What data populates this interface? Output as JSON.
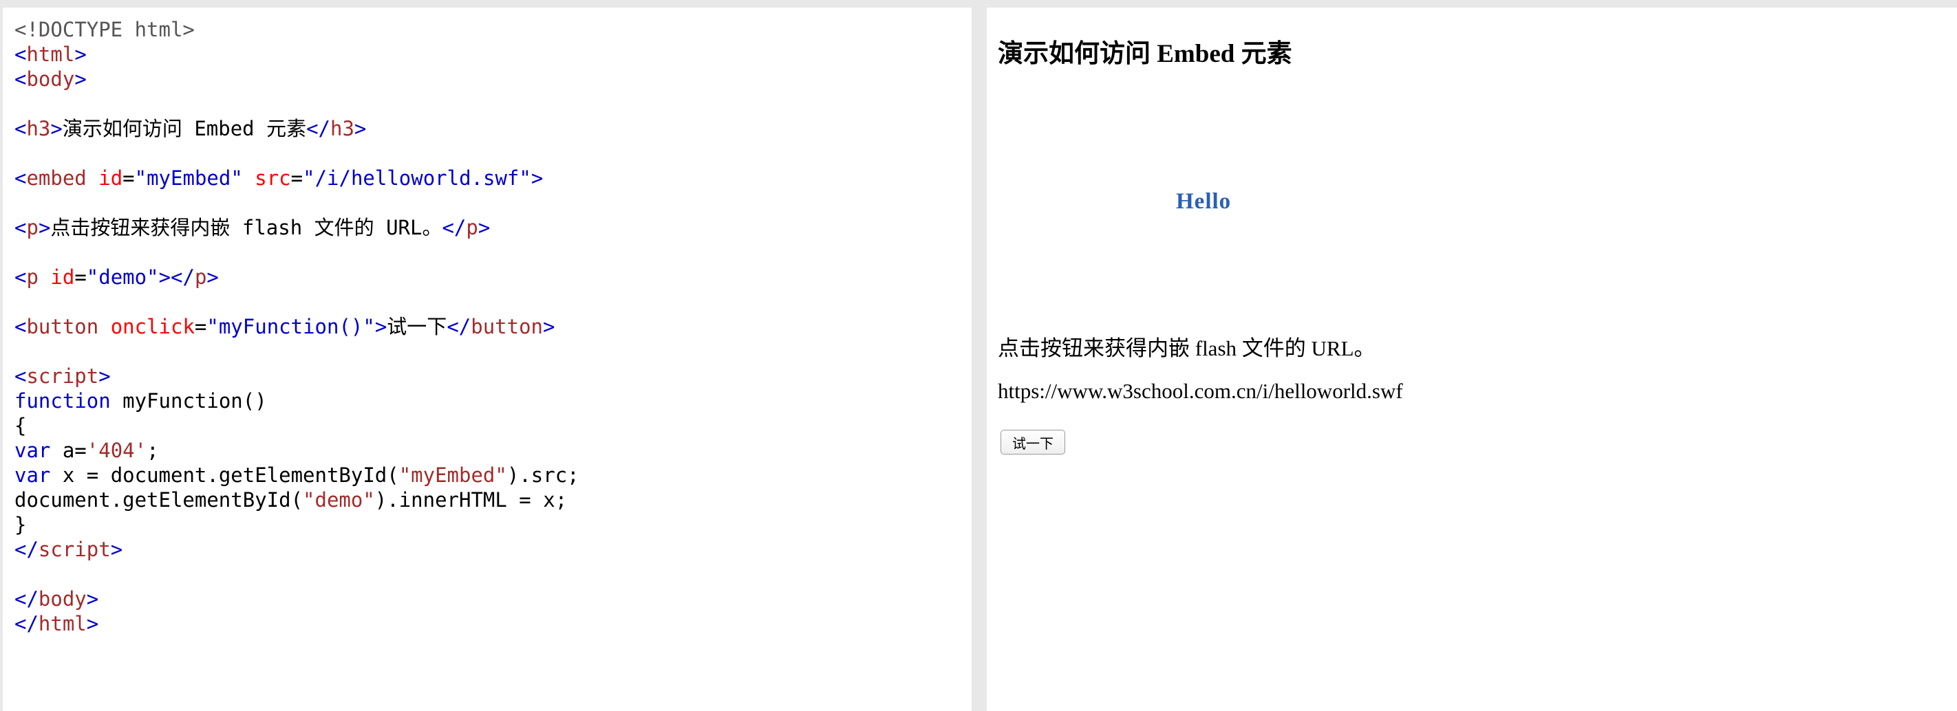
{
  "code_editor": {
    "lines": {
      "l1": "<!DOCTYPE html>",
      "l2_open": "<",
      "l2_tag": "html",
      "l2_close": ">",
      "l3_open": "<",
      "l3_tag": "body",
      "l3_close": ">",
      "l5_open": "<",
      "l5_tag": "h3",
      "l5_close": ">",
      "l5_text": "演示如何访问 Embed 元素",
      "l5_end_open": "</",
      "l5_end_tag": "h3",
      "l5_end_close": ">",
      "l7_open": "<",
      "l7_tag": "embed",
      "l7_attr1": "id",
      "l7_eq1": "=",
      "l7_val1": "\"myEmbed\"",
      "l7_attr2": "src",
      "l7_eq2": "=",
      "l7_val2": "\"/i/helloworld.swf\"",
      "l7_close": ">",
      "l9_open": "<",
      "l9_tag": "p",
      "l9_close": ">",
      "l9_text": "点击按钮来获得内嵌 flash 文件的 URL。",
      "l9_end_open": "</",
      "l9_end_tag": "p",
      "l9_end_close": ">",
      "l11_open": "<",
      "l11_tag": "p",
      "l11_attr": "id",
      "l11_eq": "=",
      "l11_val": "\"demo\"",
      "l11_close": ">",
      "l11_end_open": "</",
      "l11_end_tag": "p",
      "l11_end_close": ">",
      "l13_open": "<",
      "l13_tag": "button",
      "l13_attr": "onclick",
      "l13_eq": "=",
      "l13_val": "\"myFunction()\"",
      "l13_close": ">",
      "l13_text": "试一下",
      "l13_end_open": "</",
      "l13_end_tag": "button",
      "l13_end_close": ">",
      "l15_open": "<",
      "l15_tag": "script",
      "l15_close": ">",
      "l16_kw": "function",
      "l16_rest": " myFunction()",
      "l17": "{",
      "l18_kw": "var",
      "l18_a": " a=",
      "l18_str": "'404'",
      "l18_b": ";",
      "l19_kw": "var",
      "l19_a": " x = document.getElementById(",
      "l19_str": "\"myEmbed\"",
      "l19_b": ").src;",
      "l20_a": "document.getElementById(",
      "l20_str": "\"demo\"",
      "l20_b": ").innerHTML = x;",
      "l21": "}",
      "l22_open": "</",
      "l22_tag": "script",
      "l22_close": ">",
      "l24_open": "</",
      "l24_tag": "body",
      "l24_close": ">",
      "l25_open": "</",
      "l25_tag": "html",
      "l25_close": ">"
    }
  },
  "result": {
    "heading": "演示如何访问 Embed 元素",
    "embed_text": "Hello",
    "intro": "点击按钮来获得内嵌 flash 文件的 URL。",
    "demo_output": "https://www.w3school.com.cn/i/helloworld.swf",
    "button_label": "试一下"
  }
}
